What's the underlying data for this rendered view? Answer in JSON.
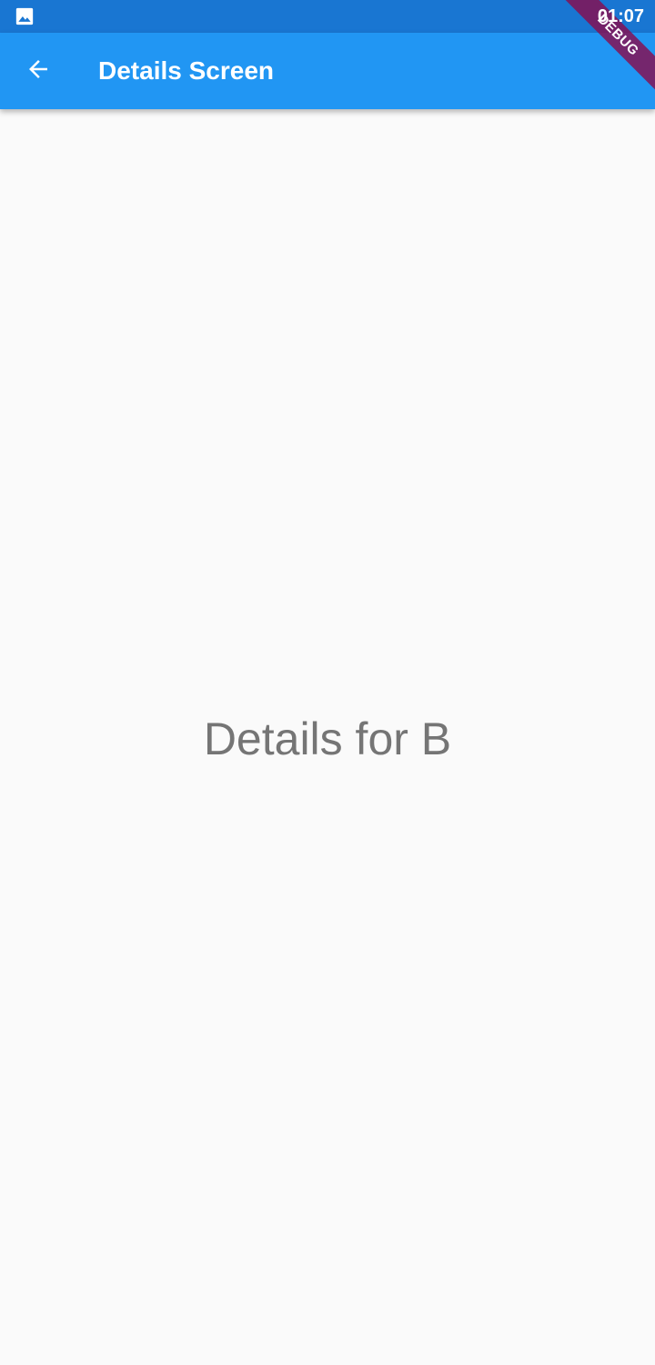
{
  "status_bar": {
    "time": "01:07",
    "notification_icon": "image-icon",
    "background_color": "#1976d2"
  },
  "app_bar": {
    "title": "Details Screen",
    "back_icon": "arrow-back-icon",
    "background_color": "#2196f3"
  },
  "body": {
    "text": "Details for B"
  },
  "debug_banner": {
    "label": "DEBUG"
  }
}
